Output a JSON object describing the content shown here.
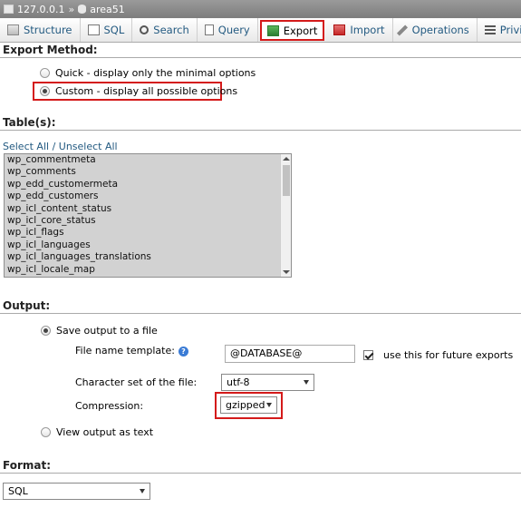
{
  "breadcrumb": {
    "server": "127.0.0.1",
    "separator": "»",
    "database": "area51"
  },
  "tabs": [
    {
      "label": "Structure",
      "icon": "structure-icon"
    },
    {
      "label": "SQL",
      "icon": "sql-icon"
    },
    {
      "label": "Search",
      "icon": "search-icon"
    },
    {
      "label": "Query",
      "icon": "query-icon"
    },
    {
      "label": "Export",
      "icon": "export-icon",
      "active": true
    },
    {
      "label": "Import",
      "icon": "import-icon"
    },
    {
      "label": "Operations",
      "icon": "operations-icon"
    },
    {
      "label": "Privileges",
      "icon": "privileges-icon"
    }
  ],
  "export_method": {
    "heading": "Export Method:",
    "quick_label": "Quick - display only the minimal options",
    "custom_label": "Custom - display all possible options",
    "selected": "custom"
  },
  "tables": {
    "heading": "Table(s):",
    "select_all_link": "Select All / Unselect All",
    "items": [
      "wp_commentmeta",
      "wp_comments",
      "wp_edd_customermeta",
      "wp_edd_customers",
      "wp_icl_content_status",
      "wp_icl_core_status",
      "wp_icl_flags",
      "wp_icl_languages",
      "wp_icl_languages_translations",
      "wp_icl_locale_map"
    ]
  },
  "output": {
    "heading": "Output:",
    "save_label": "Save output to a file",
    "filename_label": "File name template:",
    "filename_value": "@DATABASE@",
    "future_label": "use this for future exports",
    "charset_label": "Character set of the file:",
    "charset_value": "utf-8",
    "compression_label": "Compression:",
    "compression_value": "gzipped",
    "view_text_label": "View output as text"
  },
  "format": {
    "heading": "Format:",
    "value": "SQL"
  },
  "colors": {
    "highlight": "#d41a1a",
    "link": "#235a81"
  }
}
